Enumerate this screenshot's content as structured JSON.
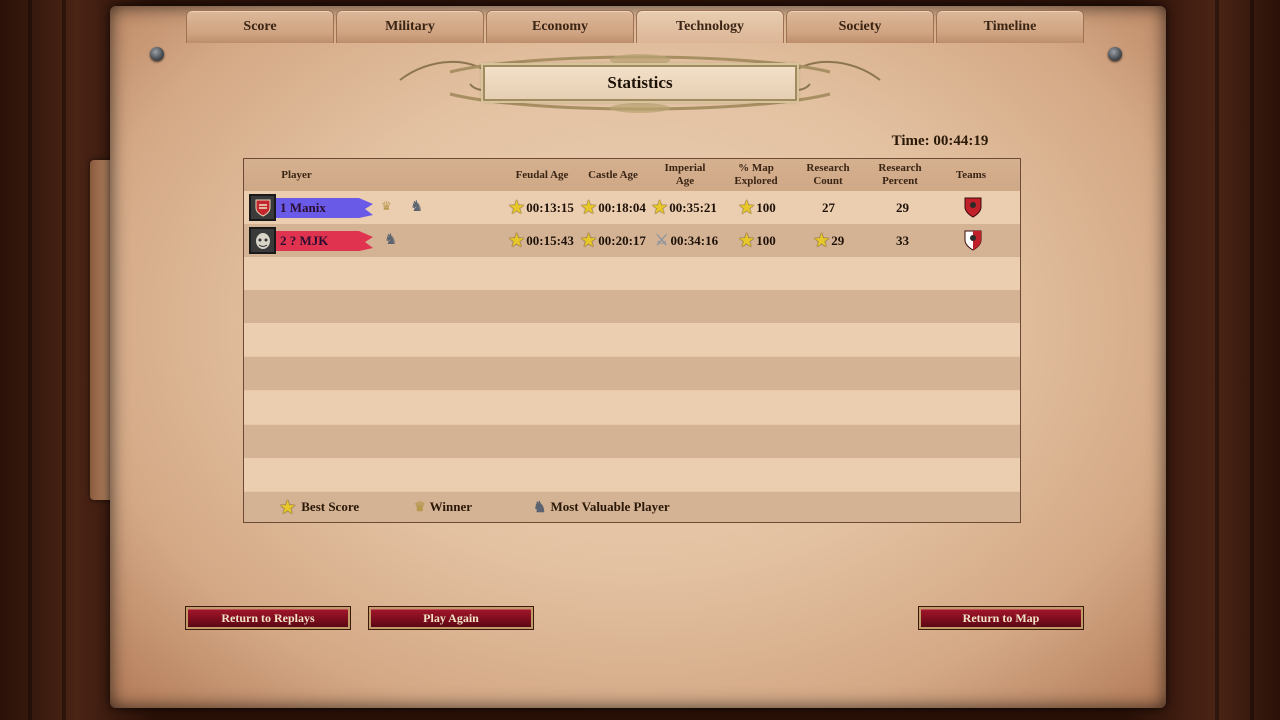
{
  "tabs": [
    {
      "label": "Score"
    },
    {
      "label": "Military"
    },
    {
      "label": "Economy"
    },
    {
      "label": "Technology",
      "active": true
    },
    {
      "label": "Society"
    },
    {
      "label": "Timeline"
    }
  ],
  "title": "Statistics",
  "time_label": "Time: 00:44:19",
  "table": {
    "headers": {
      "player": "Player",
      "feudal": "Feudal Age",
      "castle": "Castle Age",
      "imperial": "Imperial Age",
      "map_explored": "% Map Explored",
      "research_count": "Research Count",
      "research_percent": "Research Percent",
      "teams": "Teams"
    },
    "rows": [
      {
        "player": "1 Manix",
        "banner_color": "#6a5ae8",
        "feudal": "00:13:15",
        "castle": "00:18:04",
        "imperial": "00:35:21",
        "map_explored": "100",
        "research_count": "27",
        "research_percent": "29"
      },
      {
        "player": "2 ? MJK",
        "banner_color": "#e0334f",
        "feudal": "00:15:43",
        "castle": "00:20:17",
        "imperial": "00:34:16",
        "map_explored": "100",
        "research_count": "29",
        "research_percent": "33"
      }
    ]
  },
  "legend": {
    "best_score": "Best Score",
    "winner": "Winner",
    "mvp": "Most Valuable Player"
  },
  "buttons": {
    "return_replays": "Return to Replays",
    "play_again": "Play Again",
    "return_map": "Return to Map"
  },
  "icons": {
    "best_score": "star-icon",
    "winner": "crown-icon",
    "mvp": "knight-icon",
    "sword": "sword-icon"
  }
}
